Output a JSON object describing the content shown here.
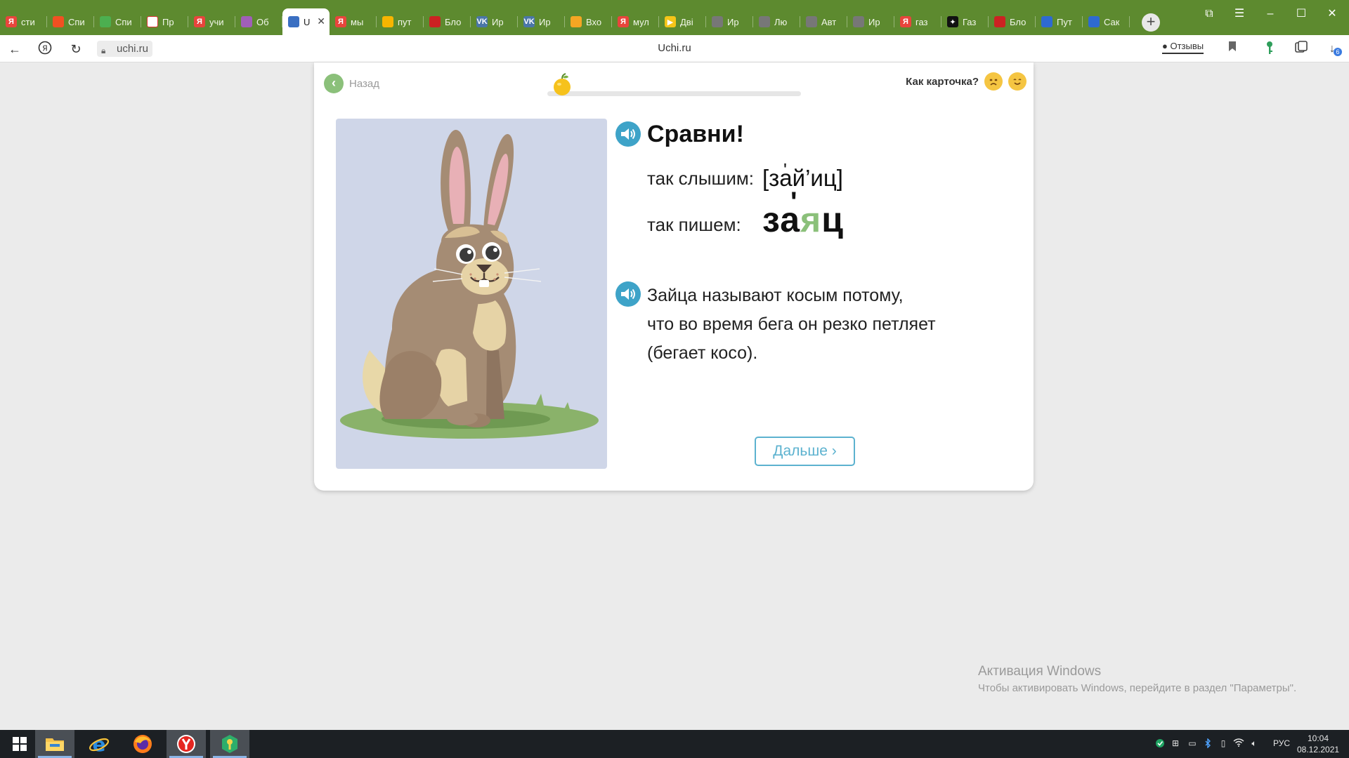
{
  "tabs": [
    {
      "label": "сти",
      "favicon": "Я",
      "color": "#e8453c"
    },
    {
      "label": "Спи",
      "favicon": "",
      "color": "#f25022"
    },
    {
      "label": "Спи",
      "favicon": "",
      "color": "#4caf50"
    },
    {
      "label": "Пр",
      "favicon": "",
      "color": "#ffffff"
    },
    {
      "label": "учи",
      "favicon": "Я",
      "color": "#e8453c"
    },
    {
      "label": "Об",
      "favicon": "",
      "color": "#a05fb8"
    },
    {
      "label": "U",
      "favicon": "",
      "color": "#3a6fc2",
      "active": true
    },
    {
      "label": "мы",
      "favicon": "Я",
      "color": "#e8453c"
    },
    {
      "label": "пут",
      "favicon": "",
      "color": "#f7b500"
    },
    {
      "label": "Бло",
      "favicon": "",
      "color": "#cc2222"
    },
    {
      "label": "Ир",
      "favicon": "VK",
      "color": "#4a76a8"
    },
    {
      "label": "Ир",
      "favicon": "VK",
      "color": "#4a76a8"
    },
    {
      "label": "Вхо",
      "favicon": "",
      "color": "#f5a623"
    },
    {
      "label": "мул",
      "favicon": "Я",
      "color": "#e8453c"
    },
    {
      "label": "Дві",
      "favicon": "▶",
      "color": "#f5c518"
    },
    {
      "label": "Ир",
      "favicon": "",
      "color": "#777777"
    },
    {
      "label": "Лю",
      "favicon": "",
      "color": "#777777"
    },
    {
      "label": "Авт",
      "favicon": "",
      "color": "#777777"
    },
    {
      "label": "Ир",
      "favicon": "",
      "color": "#777777"
    },
    {
      "label": "газ",
      "favicon": "Я",
      "color": "#e8453c"
    },
    {
      "label": "Газ",
      "favicon": "✦",
      "color": "#111111"
    },
    {
      "label": "Бло",
      "favicon": "",
      "color": "#cc2222"
    },
    {
      "label": "Пут",
      "favicon": "",
      "color": "#2e6ad1"
    },
    {
      "label": "Сак",
      "favicon": "",
      "color": "#2e6ad1"
    }
  ],
  "browser": {
    "url": "uchi.ru",
    "page_title": "Uchi.ru",
    "feedback_label": "Отзывы",
    "downloads_badge": "6"
  },
  "card": {
    "back_label": "Назад",
    "progress": 0.05,
    "rating_question": "Как карточка?",
    "heading": "Сравни!",
    "hear_label": "так слышим:",
    "hear_value": "[зай’иц]",
    "write_label": "так пишем:",
    "write_prefix": "за",
    "write_highlight": "я",
    "write_suffix": "ц",
    "fact_lines": [
      "Зайца называют косым потому,",
      "что во время бега он резко петляет",
      "(бегает косо)."
    ],
    "next_label": "Дальше ›"
  },
  "watermark": {
    "title": "Активация Windows",
    "subtitle": "Чтобы активировать Windows, перейдите в раздел \"Параметры\"."
  },
  "taskbar": {
    "lang": "РУС",
    "time": "10:04",
    "date": "08.12.2021"
  },
  "colors": {
    "tabstrip": "#5d8a2f",
    "accent_green": "#8bc07a",
    "accent_blue": "#3ea3c8",
    "button_blue": "#5cb2cf"
  }
}
